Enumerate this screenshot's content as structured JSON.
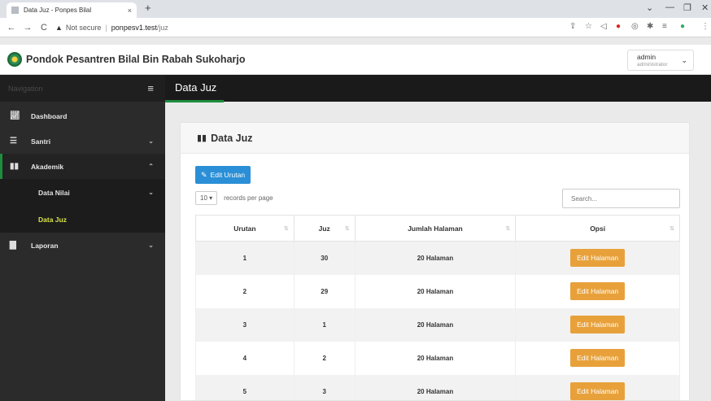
{
  "browser": {
    "tab_title": "Data Juz - Ponpes Bilal",
    "tab_close": "×",
    "new_tab": "+",
    "security": "Not secure",
    "url_host": "ponpesv1.test",
    "url_path": "/juz"
  },
  "header": {
    "brand": "Pondok Pesantren Bilal Bin Rabah Sukoharjo",
    "user_name": "admin",
    "user_role": "administrator"
  },
  "sidebar": {
    "nav_title": "Navigation",
    "items": [
      {
        "label": "Dashboard"
      },
      {
        "label": "Santri"
      },
      {
        "label": "Akademik"
      },
      {
        "label": "Data Nilai"
      },
      {
        "label": "Data Juz"
      },
      {
        "label": "Laporan"
      }
    ]
  },
  "page": {
    "title": "Data Juz",
    "card_title": "Data Juz",
    "edit_urutan": "Edit Urutan",
    "records_value": "10",
    "records_label": "records per page",
    "search_placeholder": "Search..."
  },
  "table": {
    "columns": [
      "Urutan",
      "Juz",
      "Jumlah Halaman",
      "Opsi"
    ],
    "rows": [
      {
        "urutan": "1",
        "juz": "30",
        "halaman": "20 Halaman",
        "action": "Edit Halaman"
      },
      {
        "urutan": "2",
        "juz": "29",
        "halaman": "20 Halaman",
        "action": "Edit Halaman"
      },
      {
        "urutan": "3",
        "juz": "1",
        "halaman": "20 Halaman",
        "action": "Edit Halaman"
      },
      {
        "urutan": "4",
        "juz": "2",
        "halaman": "20 Halaman",
        "action": "Edit Halaman"
      },
      {
        "urutan": "5",
        "juz": "3",
        "halaman": "20 Halaman",
        "action": "Edit Halaman"
      }
    ]
  },
  "colors": {
    "accent_green": "#1e8e3e",
    "button_blue": "#2a8fd6",
    "button_orange": "#e8a13a",
    "sidebar_bg": "#2b2b2b"
  }
}
